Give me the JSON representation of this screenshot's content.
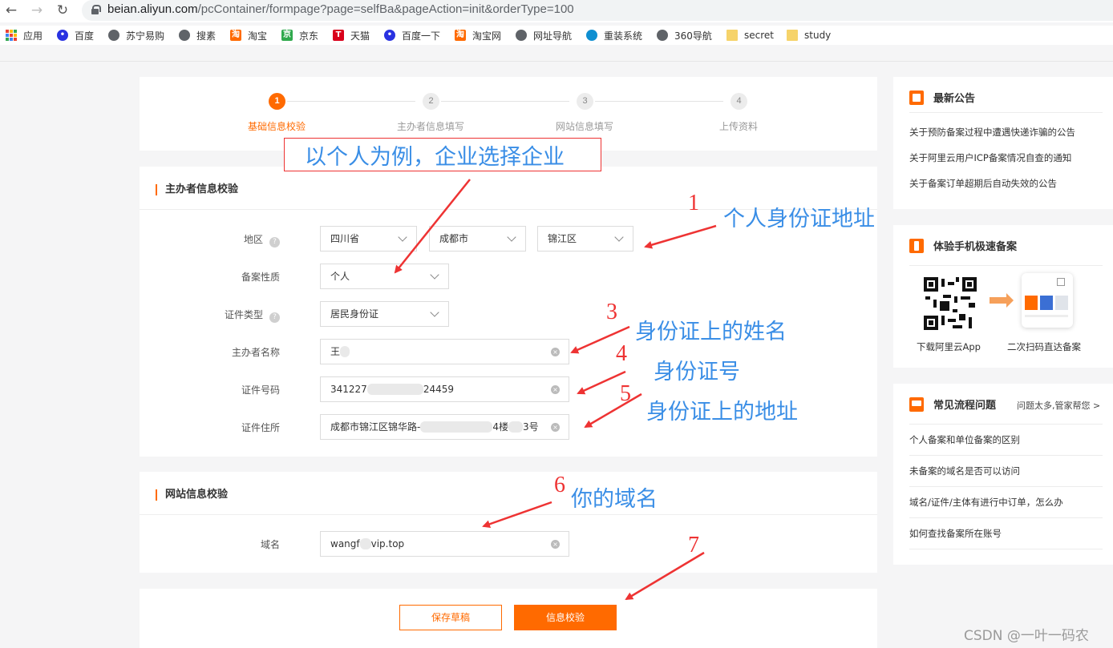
{
  "browser": {
    "url_host": "beian.aliyun.com",
    "url_path": "/pcContainer/formpage?page=selfBa&pageAction=init&orderType=100",
    "bookmarks": [
      {
        "label": "应用",
        "icon": "apps-grid-icon"
      },
      {
        "label": "百度",
        "icon": "baidu-paw-icon"
      },
      {
        "label": "苏宁易购",
        "icon": "globe-icon"
      },
      {
        "label": "搜素",
        "icon": "globe-icon"
      },
      {
        "label": "淘宝",
        "icon": "taobao-icon"
      },
      {
        "label": "京东",
        "icon": "jd-icon"
      },
      {
        "label": "天猫",
        "icon": "tmall-icon"
      },
      {
        "label": "百度一下",
        "icon": "baidu-paw-icon"
      },
      {
        "label": "淘宝网",
        "icon": "taobao-icon"
      },
      {
        "label": "网址导航",
        "icon": "globe-icon"
      },
      {
        "label": "重装系统",
        "icon": "cpu-icon"
      },
      {
        "label": "360导航",
        "icon": "globe-icon"
      },
      {
        "label": "secret",
        "icon": "folder-icon"
      },
      {
        "label": "study",
        "icon": "folder-icon"
      }
    ]
  },
  "steps": [
    {
      "num": "1",
      "label": "基础信息校验",
      "active": true
    },
    {
      "num": "2",
      "label": "主办者信息填写",
      "active": false
    },
    {
      "num": "3",
      "label": "网站信息填写",
      "active": false
    },
    {
      "num": "4",
      "label": "上传资料",
      "active": false
    }
  ],
  "sponsor_section": {
    "title": "主办者信息校验",
    "region_label": "地区",
    "province": "四川省",
    "city": "成都市",
    "district": "锦江区",
    "nature_label": "备案性质",
    "nature": "个人",
    "doc_type_label": "证件类型",
    "doc_type": "居民身份证",
    "name_label": "主办者名称",
    "name_value": "王",
    "id_label": "证件号码",
    "id_prefix": "341227",
    "id_suffix": "24459",
    "address_label": "证件住所",
    "address_prefix": "成都市锦江区锦华路-",
    "address_mid": "4楼",
    "address_suffix": "3号"
  },
  "website_section": {
    "title": "网站信息校验",
    "domain_label": "域名",
    "domain_prefix": "wangf",
    "domain_suffix": "vip.top"
  },
  "actions": {
    "save_draft": "保存草稿",
    "verify": "信息校验"
  },
  "side": {
    "notice_title": "最新公告",
    "notices": [
      "关于预防备案过程中遭遇快递诈骗的公告",
      "关于阿里云用户ICP备案情况自查的通知",
      "关于备案订单超期后自动失效的公告"
    ],
    "mobile_title": "体验手机极速备案",
    "qr_caption_left": "下载阿里云App",
    "qr_caption_right": "二次扫码直达备案",
    "faq_title": "常见流程问题",
    "faq_more": "问题太多,管家帮您 >",
    "faqs": [
      "个人备案和单位备案的区别",
      "未备案的域名是否可以访问",
      "域名/证件/主体有进行中订单，怎么办",
      "如何查找备案所在账号"
    ]
  },
  "annotations": {
    "top_box": "以个人为例，企业选择企业",
    "n1": "1",
    "t1": "个人身份证地址",
    "n3": "3",
    "t3": "身份证上的姓名",
    "n4": "4",
    "t4": "身份证号",
    "n5": "5",
    "t5": "身份证上的地址",
    "n6": "6",
    "t6": "你的域名",
    "n7": "7"
  },
  "watermark": "CSDN @一叶一码农",
  "colors": {
    "accent": "#ff6a00",
    "annotation_red": "#ee3333",
    "annotation_blue": "#3a8ee6"
  }
}
